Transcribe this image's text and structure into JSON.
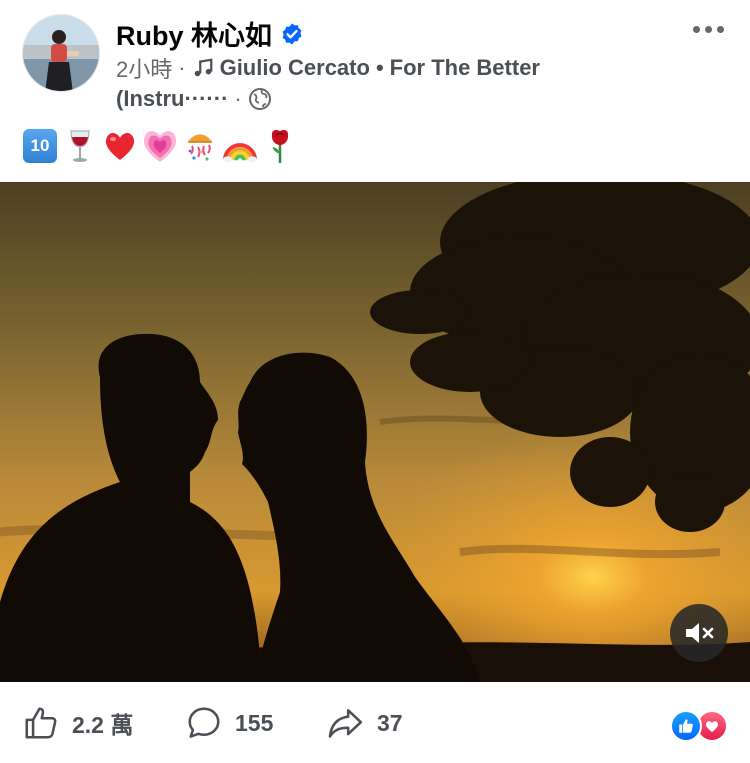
{
  "post": {
    "author": "Ruby 林心如",
    "time": "2小時",
    "separator": "·",
    "song_line1": "Giulio Cercato",
    "song_sep": "•",
    "song_title_part1": "For The Better",
    "song_title_part2": "(Instru······",
    "emojis": [
      "keycap-10",
      "wine-glass",
      "red-heart",
      "growing-heart",
      "confetti-ball",
      "rainbow",
      "rose"
    ],
    "keycap_text": "10"
  },
  "stats": {
    "likes": "2.2 萬",
    "comments": "155",
    "shares": "37"
  },
  "colors": {
    "verified": "#0866ff",
    "meta": "#65676b",
    "like": "#0866ff",
    "love": "#f33e58"
  }
}
